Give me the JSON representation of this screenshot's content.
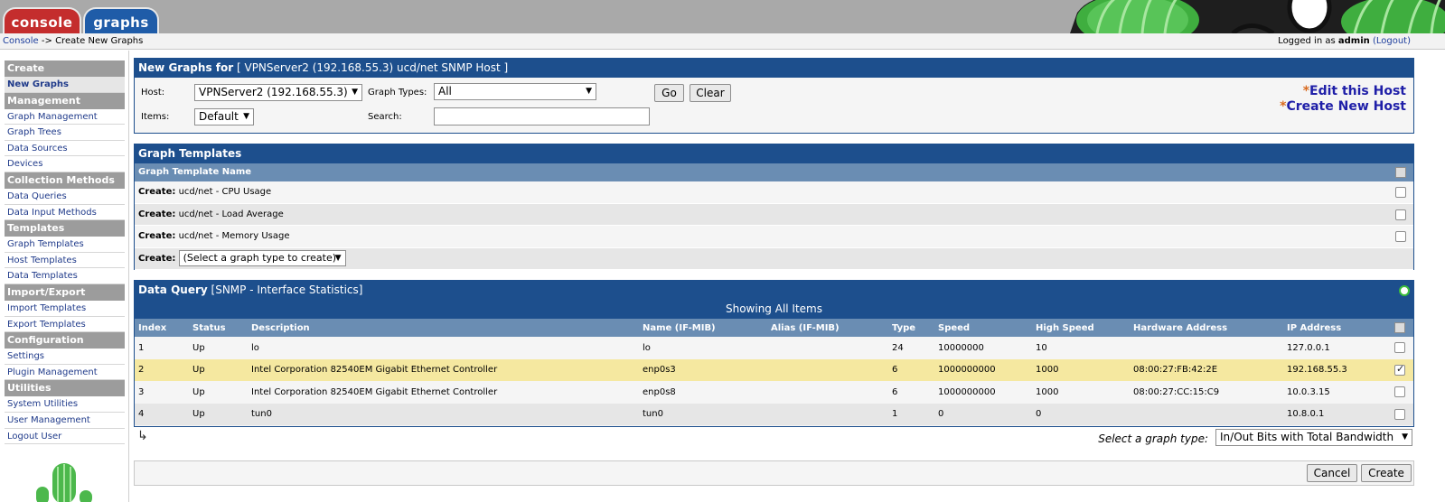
{
  "tabs": {
    "console": "console",
    "graphs": "graphs"
  },
  "breadcrumb": {
    "root": "Console",
    "separator": "->",
    "current": "Create New Graphs"
  },
  "login": {
    "prefix": "Logged in as",
    "user": "admin",
    "logout": "(Logout)"
  },
  "sidebar": {
    "sections": [
      {
        "title": "Create",
        "items": [
          {
            "label": "New Graphs",
            "active": true
          }
        ]
      },
      {
        "title": "Management",
        "items": [
          {
            "label": "Graph Management"
          },
          {
            "label": "Graph Trees"
          },
          {
            "label": "Data Sources"
          },
          {
            "label": "Devices"
          }
        ]
      },
      {
        "title": "Collection Methods",
        "items": [
          {
            "label": "Data Queries"
          },
          {
            "label": "Data Input Methods"
          }
        ]
      },
      {
        "title": "Templates",
        "items": [
          {
            "label": "Graph Templates"
          },
          {
            "label": "Host Templates"
          },
          {
            "label": "Data Templates"
          }
        ]
      },
      {
        "title": "Import/Export",
        "items": [
          {
            "label": "Import Templates"
          },
          {
            "label": "Export Templates"
          }
        ]
      },
      {
        "title": "Configuration",
        "items": [
          {
            "label": "Settings"
          },
          {
            "label": "Plugin Management"
          }
        ]
      },
      {
        "title": "Utilities",
        "items": [
          {
            "label": "System Utilities"
          },
          {
            "label": "User Management"
          },
          {
            "label": "Logout User"
          }
        ]
      }
    ]
  },
  "filter": {
    "title_bold": "New Graphs for",
    "title_rest": "[ VPNServer2 (192.168.55.3) ucd/net SNMP Host ]",
    "host_label": "Host:",
    "host_value": "VPNServer2 (192.168.55.3)",
    "graph_types_label": "Graph Types:",
    "graph_types_value": "All",
    "items_label": "Items:",
    "items_value": "Default",
    "search_label": "Search:",
    "search_value": "",
    "go": "Go",
    "clear": "Clear",
    "edit_host": "Edit this Host",
    "create_host": "Create New Host",
    "star": "*"
  },
  "templates": {
    "title": "Graph Templates",
    "column": "Graph Template Name",
    "create_prefix": "Create:",
    "rows": [
      {
        "name": "ucd/net - CPU Usage"
      },
      {
        "name": "ucd/net - Load Average"
      },
      {
        "name": "ucd/net - Memory Usage"
      }
    ],
    "select_placeholder": "(Select a graph type to create)"
  },
  "query": {
    "title_bold": "Data Query",
    "title_rest": "[SNMP - Interface Statistics]",
    "showing": "Showing All Items",
    "columns": [
      "Index",
      "Status",
      "Description",
      "Name (IF-MIB)",
      "Alias (IF-MIB)",
      "Type",
      "Speed",
      "High Speed",
      "Hardware Address",
      "IP Address"
    ],
    "rows": [
      {
        "index": "1",
        "status": "Up",
        "description": "lo",
        "name": "lo",
        "alias": "",
        "type": "24",
        "speed": "10000000",
        "high_speed": "10",
        "hw": "",
        "ip": "127.0.0.1",
        "checked": false
      },
      {
        "index": "2",
        "status": "Up",
        "description": "Intel Corporation 82540EM Gigabit Ethernet Controller",
        "name": "enp0s3",
        "alias": "",
        "type": "6",
        "speed": "1000000000",
        "high_speed": "1000",
        "hw": "08:00:27:FB:42:2E",
        "ip": "192.168.55.3",
        "checked": true
      },
      {
        "index": "3",
        "status": "Up",
        "description": "Intel Corporation 82540EM Gigabit Ethernet Controller",
        "name": "enp0s8",
        "alias": "",
        "type": "6",
        "speed": "1000000000",
        "high_speed": "1000",
        "hw": "08:00:27:CC:15:C9",
        "ip": "10.0.3.15",
        "checked": false
      },
      {
        "index": "4",
        "status": "Up",
        "description": "tun0",
        "name": "tun0",
        "alias": "",
        "type": "1",
        "speed": "0",
        "high_speed": "0",
        "hw": "",
        "ip": "10.8.0.1",
        "checked": false
      }
    ],
    "graph_type_label": "Select a graph type:",
    "graph_type_value": "In/Out Bits with Total Bandwidth"
  },
  "actions": {
    "cancel": "Cancel",
    "create": "Create"
  },
  "colors": {
    "panel_header": "#1d4f8d",
    "subheader": "#6a8db3",
    "selected_row": "#f5e8a0",
    "console_tab": "#c42d2d",
    "graphs_tab": "#1f5ca8"
  }
}
